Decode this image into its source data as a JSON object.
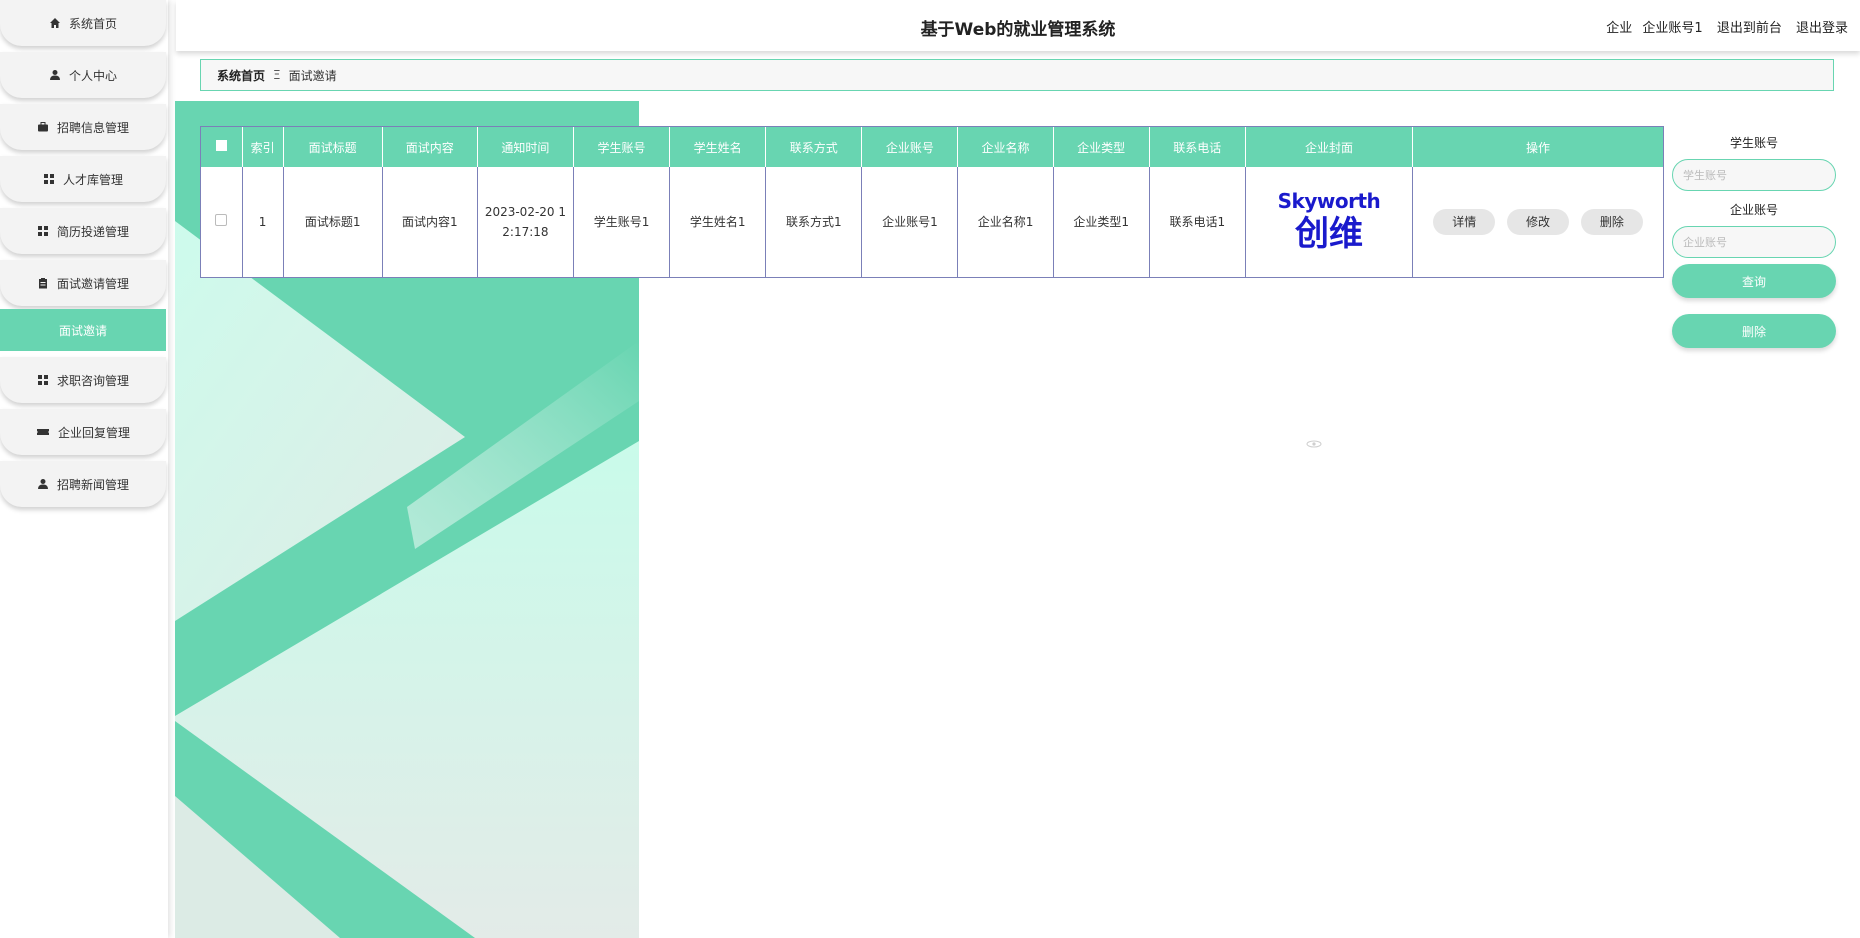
{
  "app": {
    "title": "基于Web的就业管理系统",
    "user_role": "企业",
    "user_account": "企业账号1",
    "to_frontend": "退出到前台",
    "logout": "退出登录"
  },
  "sidebar": {
    "items": [
      {
        "label": "系统首页",
        "icon": "home-icon"
      },
      {
        "label": "个人中心",
        "icon": "user-icon"
      },
      {
        "label": "招聘信息管理",
        "icon": "briefcase-icon"
      },
      {
        "label": "人才库管理",
        "icon": "grid-icon"
      },
      {
        "label": "简历投递管理",
        "icon": "grid-icon"
      },
      {
        "label": "面试邀请管理",
        "icon": "clipboard-icon"
      },
      {
        "label": "面试邀请",
        "icon": ""
      },
      {
        "label": "求职咨询管理",
        "icon": "grid-icon"
      },
      {
        "label": "企业回复管理",
        "icon": "ticket-icon"
      },
      {
        "label": "招聘新闻管理",
        "icon": "user-icon"
      }
    ],
    "active_index": 6
  },
  "breadcrumb": {
    "home": "系统首页",
    "separator": "Ξ",
    "current": "面试邀请"
  },
  "table": {
    "headers": [
      "索引",
      "面试标题",
      "面试内容",
      "通知时间",
      "学生账号",
      "学生姓名",
      "联系方式",
      "企业账号",
      "企业名称",
      "企业类型",
      "联系电话",
      "企业封面",
      "操作"
    ],
    "rows": [
      {
        "index": "1",
        "title": "面试标题1",
        "content": "面试内容1",
        "time_line1": "2023-02-20 1",
        "time_line2": "2:17:18",
        "student_account": "学生账号1",
        "student_name": "学生姓名1",
        "contact": "联系方式1",
        "company_account": "企业账号1",
        "company_name": "企业名称1",
        "company_type": "企业类型1",
        "phone": "联系电话1",
        "cover_logo_en": "Skyworth",
        "cover_logo_cn": "创维"
      }
    ],
    "actions": [
      "详情",
      "修改",
      "删除"
    ]
  },
  "search": {
    "student_label": "学生账号",
    "student_placeholder": "学生账号",
    "company_label": "企业账号",
    "company_placeholder": "企业账号",
    "query_button": "查询",
    "delete_button": "删除"
  },
  "colors": {
    "accent": "#68d5b1",
    "table_border": "#7b80b8",
    "logo": "#1a1acc"
  }
}
